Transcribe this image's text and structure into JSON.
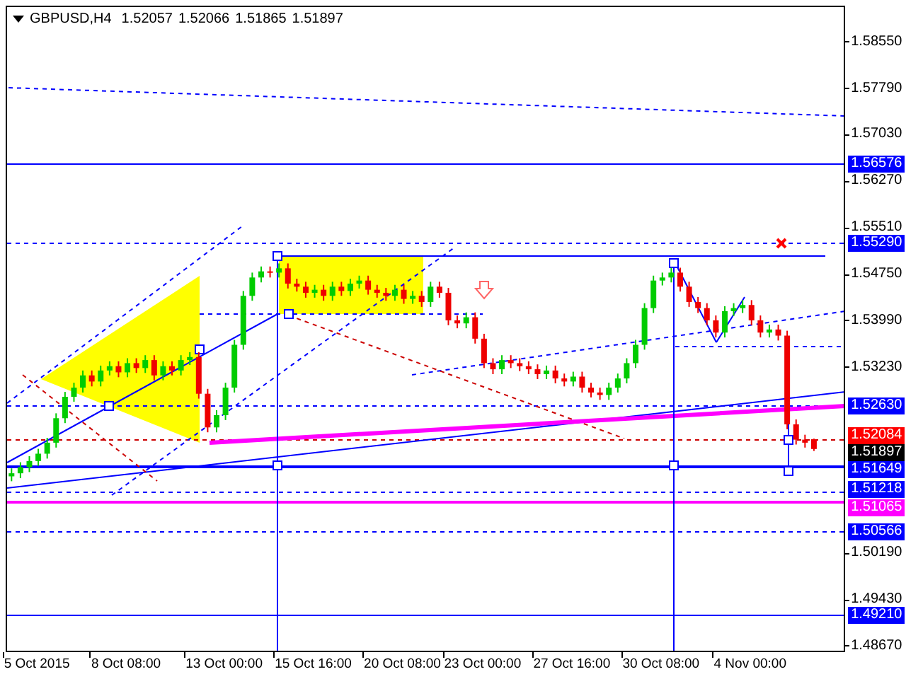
{
  "header": {
    "symbol": "GBPUSD,H4",
    "quotes": [
      "1.52057",
      "1.52066",
      "1.51865",
      "1.51897"
    ]
  },
  "chart": {
    "chart_data": {
      "type": "candlestick",
      "ylim": [
        1.486,
        1.5912
      ],
      "categories": [
        null,
        null,
        null,
        "5 Oct 2015",
        null,
        null,
        null,
        null,
        null,
        null,
        null,
        null,
        null,
        "8 Oct 08:00",
        null,
        null,
        null,
        null,
        null,
        null,
        null,
        null,
        null,
        null,
        "13 Oct 00:00",
        null,
        null,
        null,
        null,
        null,
        null,
        null,
        null,
        null,
        "15 Oct 16:00",
        null,
        null,
        null,
        null,
        null,
        null,
        null,
        null,
        null,
        "20 Oct 08:00",
        null,
        null,
        null,
        null,
        null,
        null,
        null,
        null,
        "23 Oct 00:00",
        null,
        null,
        null,
        null,
        null,
        null,
        null,
        null,
        null,
        "27 Oct 16:00",
        null,
        null,
        null,
        null,
        null,
        null,
        null,
        null,
        null,
        "30 Oct 08:00",
        null,
        null,
        null,
        null,
        null,
        null,
        null,
        null,
        null,
        "4 Nov 00:00",
        null,
        null,
        null,
        null,
        null,
        null,
        null,
        null,
        null,
        null
      ],
      "ohlc": [
        [
          1.5145,
          1.5158,
          1.5137,
          1.515
        ],
        [
          1.515,
          1.5168,
          1.5142,
          1.516
        ],
        [
          1.516,
          1.5178,
          1.5152,
          1.517
        ],
        [
          1.517,
          1.519,
          1.5162,
          1.5182
        ],
        [
          1.5182,
          1.5208,
          1.5174,
          1.52
        ],
        [
          1.52,
          1.5248,
          1.5192,
          1.524
        ],
        [
          1.524,
          1.5283,
          1.5232,
          1.5275
        ],
        [
          1.5275,
          1.5298,
          1.5267,
          1.529
        ],
        [
          1.529,
          1.5318,
          1.5282,
          1.531
        ],
        [
          1.531,
          1.5318,
          1.5292,
          1.53
        ],
        [
          1.53,
          1.5326,
          1.5292,
          1.5318
        ],
        [
          1.5318,
          1.5333,
          1.531,
          1.5325
        ],
        [
          1.5325,
          1.5333,
          1.5307,
          1.5315
        ],
        [
          1.5315,
          1.5338,
          1.5307,
          1.533
        ],
        [
          1.533,
          1.5338,
          1.5314,
          1.5322
        ],
        [
          1.5322,
          1.5343,
          1.5314,
          1.5335
        ],
        [
          1.5335,
          1.5343,
          1.5302,
          1.531
        ],
        [
          1.531,
          1.5333,
          1.5302,
          1.5325
        ],
        [
          1.5325,
          1.5333,
          1.531,
          1.5318
        ],
        [
          1.5318,
          1.5343,
          1.531,
          1.5335
        ],
        [
          1.5335,
          1.5348,
          1.5327,
          1.534
        ],
        [
          1.534,
          1.5348,
          1.5272,
          1.528
        ],
        [
          1.528,
          1.5288,
          1.5217,
          1.5225
        ],
        [
          1.5225,
          1.5253,
          1.5217,
          1.5245
        ],
        [
          1.5245,
          1.5298,
          1.5237,
          1.529
        ],
        [
          1.529,
          1.5368,
          1.5282,
          1.536
        ],
        [
          1.536,
          1.5448,
          1.5352,
          1.544
        ],
        [
          1.544,
          1.5478,
          1.5432,
          1.547
        ],
        [
          1.547,
          1.5488,
          1.5462,
          1.548
        ],
        [
          1.548,
          1.5488,
          1.547,
          1.5478
        ],
        [
          1.5478,
          1.5493,
          1.547,
          1.5485
        ],
        [
          1.5485,
          1.5493,
          1.5452,
          1.546
        ],
        [
          1.546,
          1.5468,
          1.5447,
          1.5455
        ],
        [
          1.5455,
          1.5463,
          1.5437,
          1.5445
        ],
        [
          1.5445,
          1.5458,
          1.5437,
          1.545
        ],
        [
          1.545,
          1.5458,
          1.5432,
          1.544
        ],
        [
          1.544,
          1.5463,
          1.5432,
          1.5455
        ],
        [
          1.5455,
          1.5463,
          1.544,
          1.5448
        ],
        [
          1.5448,
          1.5468,
          1.544,
          1.546
        ],
        [
          1.546,
          1.5473,
          1.5452,
          1.5465
        ],
        [
          1.5465,
          1.5473,
          1.5442,
          1.545
        ],
        [
          1.545,
          1.5458,
          1.5437,
          1.5445
        ],
        [
          1.5445,
          1.5453,
          1.5432,
          1.544
        ],
        [
          1.544,
          1.5458,
          1.5432,
          1.545
        ],
        [
          1.545,
          1.5458,
          1.5427,
          1.5435
        ],
        [
          1.5435,
          1.5448,
          1.5427,
          1.544
        ],
        [
          1.544,
          1.5448,
          1.5422,
          1.543
        ],
        [
          1.543,
          1.5463,
          1.5422,
          1.5455
        ],
        [
          1.5455,
          1.5463,
          1.5437,
          1.5445
        ],
        [
          1.5445,
          1.5453,
          1.5392,
          1.54
        ],
        [
          1.54,
          1.5408,
          1.5387,
          1.5395
        ],
        [
          1.5395,
          1.5413,
          1.5387,
          1.5405
        ],
        [
          1.5405,
          1.5413,
          1.5362,
          1.537
        ],
        [
          1.537,
          1.5378,
          1.5322,
          1.533
        ],
        [
          1.533,
          1.5338,
          1.5312,
          1.532
        ],
        [
          1.532,
          1.5343,
          1.5312,
          1.5335
        ],
        [
          1.5335,
          1.5343,
          1.5322,
          1.533
        ],
        [
          1.533,
          1.5338,
          1.5317,
          1.5325
        ],
        [
          1.5325,
          1.5333,
          1.5312,
          1.532
        ],
        [
          1.532,
          1.5328,
          1.5304,
          1.5312
        ],
        [
          1.5312,
          1.5326,
          1.5304,
          1.5318
        ],
        [
          1.5318,
          1.5326,
          1.5297,
          1.5305
        ],
        [
          1.5305,
          1.5313,
          1.5292,
          1.53
        ],
        [
          1.53,
          1.5316,
          1.5292,
          1.5308
        ],
        [
          1.5308,
          1.5316,
          1.5282,
          1.529
        ],
        [
          1.529,
          1.5298,
          1.5274,
          1.5282
        ],
        [
          1.5282,
          1.529,
          1.527,
          1.5278
        ],
        [
          1.5278,
          1.5298,
          1.527,
          1.529
        ],
        [
          1.529,
          1.5313,
          1.5282,
          1.5305
        ],
        [
          1.5305,
          1.5338,
          1.5297,
          1.533
        ],
        [
          1.533,
          1.5368,
          1.5322,
          1.536
        ],
        [
          1.536,
          1.5428,
          1.5352,
          1.542
        ],
        [
          1.542,
          1.5473,
          1.5412,
          1.5465
        ],
        [
          1.5465,
          1.5478,
          1.5457,
          1.547
        ],
        [
          1.547,
          1.5486,
          1.5462,
          1.5478
        ],
        [
          1.5478,
          1.5486,
          1.5447,
          1.5455
        ],
        [
          1.5455,
          1.5463,
          1.5422,
          1.543
        ],
        [
          1.543,
          1.5438,
          1.5412,
          1.542
        ],
        [
          1.542,
          1.5428,
          1.5392,
          1.54
        ],
        [
          1.54,
          1.5408,
          1.5372,
          1.538
        ],
        [
          1.538,
          1.5423,
          1.5372,
          1.5415
        ],
        [
          1.5415,
          1.5428,
          1.5407,
          1.542
        ],
        [
          1.542,
          1.5433,
          1.5412,
          1.5425
        ],
        [
          1.5425,
          1.5433,
          1.5392,
          1.54
        ],
        [
          1.54,
          1.5408,
          1.5372,
          1.538
        ],
        [
          1.538,
          1.5393,
          1.5372,
          1.5385
        ],
        [
          1.5385,
          1.5393,
          1.5367,
          1.5375
        ],
        [
          1.5375,
          1.5383,
          1.5222,
          1.523
        ],
        [
          1.523,
          1.5238,
          1.5197,
          1.5205
        ],
        [
          1.5205,
          1.5213,
          1.5192,
          1.52
        ],
        [
          1.52057,
          1.52066,
          1.51865,
          1.51897
        ],
        null,
        null,
        null
      ],
      "yticks": [
        {
          "value": 1.5855,
          "label": "1.58550"
        },
        {
          "value": 1.5779,
          "label": "1.57790"
        },
        {
          "value": 1.5703,
          "label": "1.57030"
        },
        {
          "value": 1.5627,
          "label": "1.56270"
        },
        {
          "value": 1.5551,
          "label": "1.55510"
        },
        {
          "value": 1.5475,
          "label": "1.54750"
        },
        {
          "value": 1.5399,
          "label": "1.53990"
        },
        {
          "value": 1.5323,
          "label": "1.53230"
        },
        {
          "value": 1.5019,
          "label": "1.50190"
        },
        {
          "value": 1.4943,
          "label": "1.49430"
        },
        {
          "value": 1.4867,
          "label": "1.48670"
        }
      ]
    }
  },
  "level_labels": [
    {
      "text": "1.56576",
      "color": "#0000ff"
    },
    {
      "text": "1.55290",
      "color": "#0000ff"
    },
    {
      "text": "1.52630",
      "color": "#0000ff"
    },
    {
      "text": "1.52084",
      "color": "#ff0000"
    },
    {
      "text": "1.51897",
      "color": "#000000"
    },
    {
      "text": "1.51649",
      "color": "#0000ff"
    },
    {
      "text": "1.51218",
      "color": "#0000ff"
    },
    {
      "text": "1.51065",
      "color": "#ff00ff"
    },
    {
      "text": "1.50566",
      "color": "#0000ff"
    },
    {
      "text": "1.49210",
      "color": "#0000ff"
    }
  ]
}
